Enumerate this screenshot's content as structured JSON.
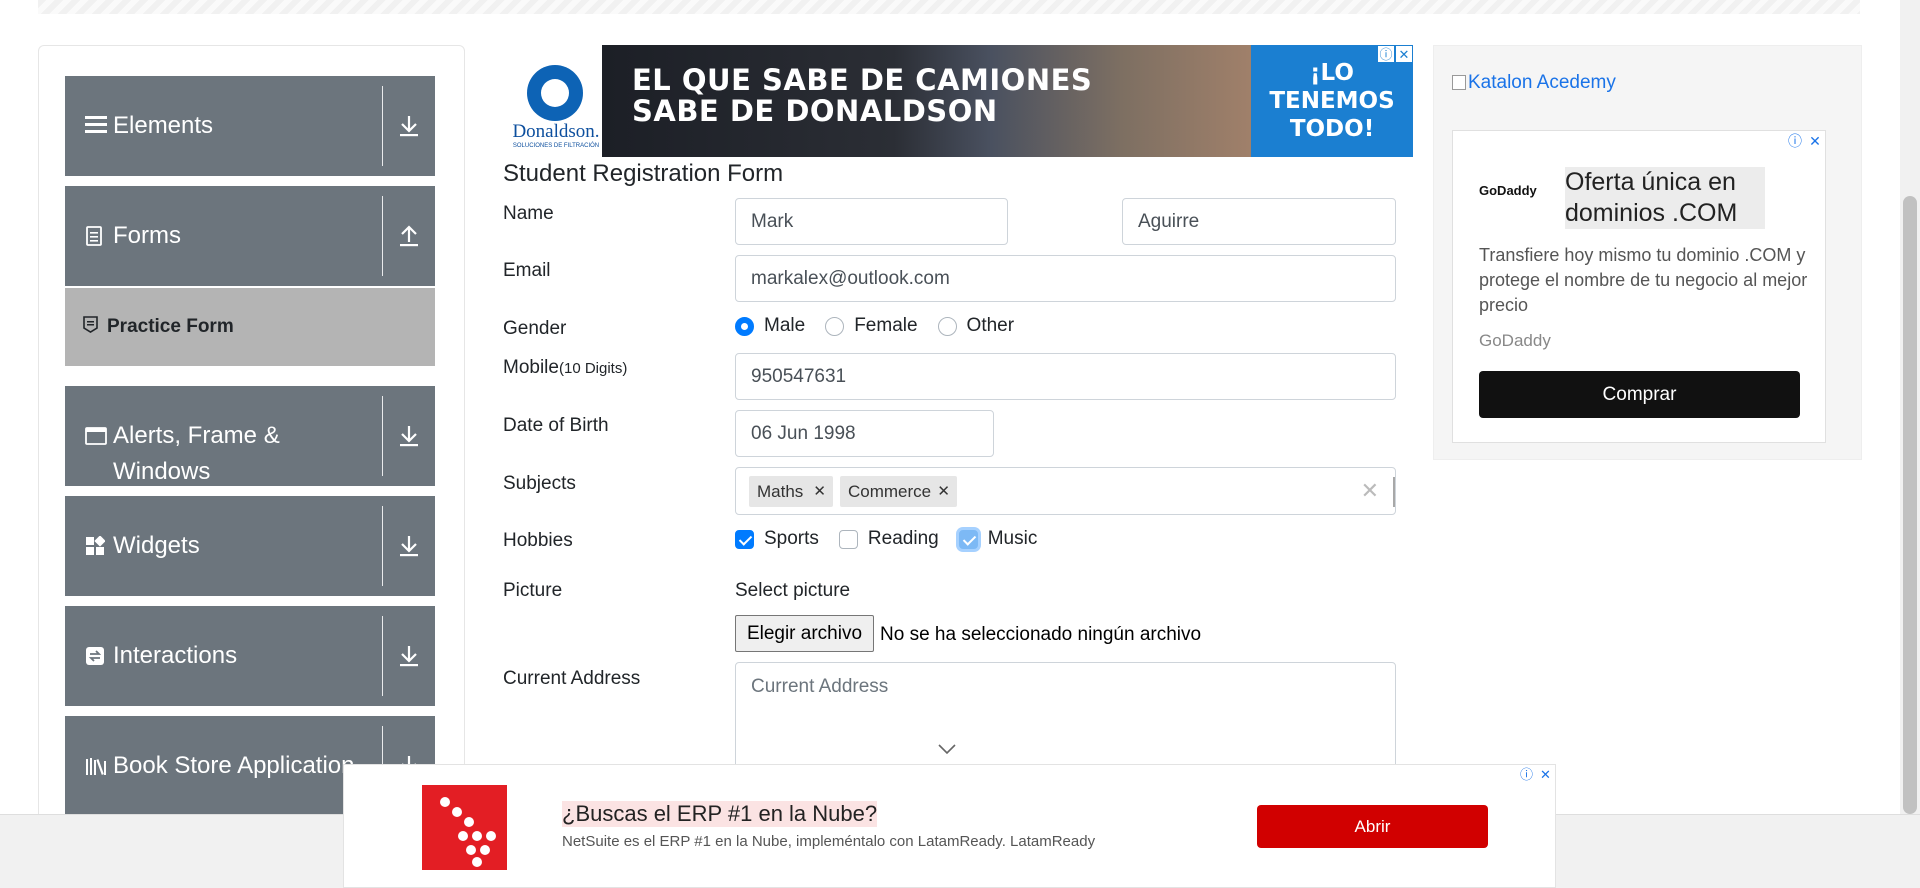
{
  "nav": {
    "groups": [
      {
        "label": "Elements",
        "icon": "hamburger-icon",
        "toggle": "download-arrow-icon"
      },
      {
        "label": "Forms",
        "icon": "document-icon",
        "toggle": "upload-arrow-icon"
      },
      {
        "label": "Alerts, Frame & Windows",
        "icon": "window-icon",
        "toggle": "download-arrow-icon"
      },
      {
        "label": "Widgets",
        "icon": "widgets-icon",
        "toggle": "download-arrow-icon"
      },
      {
        "label": "Interactions",
        "icon": "interactions-icon",
        "toggle": "download-arrow-icon"
      },
      {
        "label": "Book Store Application",
        "icon": "books-icon",
        "toggle": "download-arrow-icon"
      }
    ],
    "active_item": "Practice Form"
  },
  "ad_top": {
    "logo_text": "Donaldson.",
    "logo_sub": "SOLUCIONES DE FILTRACIÓN",
    "headline_line1": "EL QUE SABE DE CAMIONES",
    "headline_line2": "SABE DE DONALDSON",
    "cta_line1": "¡LO",
    "cta_line2": "TENEMOS",
    "cta_line3": "TODO!"
  },
  "form": {
    "title": "Student Registration Form",
    "name_label": "Name",
    "first_name": "Mark",
    "last_name": "Aguirre",
    "email_label": "Email",
    "email": "markalex@outlook.com",
    "gender_label": "Gender",
    "gender_options": [
      "Male",
      "Female",
      "Other"
    ],
    "gender_selected": "Male",
    "mobile_label": "Mobile",
    "mobile_hint": "(10 Digits)",
    "mobile": "950547631",
    "dob_label": "Date of Birth",
    "dob": "06 Jun 1998",
    "subjects_label": "Subjects",
    "subjects": [
      "Maths",
      "Commerce"
    ],
    "hobbies_label": "Hobbies",
    "hobbies": [
      {
        "label": "Sports",
        "checked": true
      },
      {
        "label": "Reading",
        "checked": false
      },
      {
        "label": "Music",
        "checked": true
      }
    ],
    "picture_label": "Picture",
    "picture_caption": "Select picture",
    "file_button": "Elegir archivo",
    "file_status": "No se ha seleccionado ningún archivo",
    "address_label": "Current Address",
    "address_placeholder": "Current Address"
  },
  "ad_right": {
    "broken_image_alt": "Katalon Acedemy",
    "logo": "GoDaddy",
    "title": "Oferta única en dominios .COM",
    "body": "Transfiere hoy mismo tu dominio .COM y protege el nombre de tu negocio al mejor precio",
    "brand": "GoDaddy",
    "button": "Comprar"
  },
  "ad_bottom": {
    "title": "¿Buscas el ERP #1 en la Nube?",
    "description": "NetSuite es el ERP #1 en la Nube, impleméntalo con LatamReady. LatamReady",
    "button": "Abrir"
  },
  "colors": {
    "nav_group": "#6c757d",
    "nav_active": "#b4b4b4",
    "primary": "#007bff",
    "ad_red": "#d10000"
  }
}
